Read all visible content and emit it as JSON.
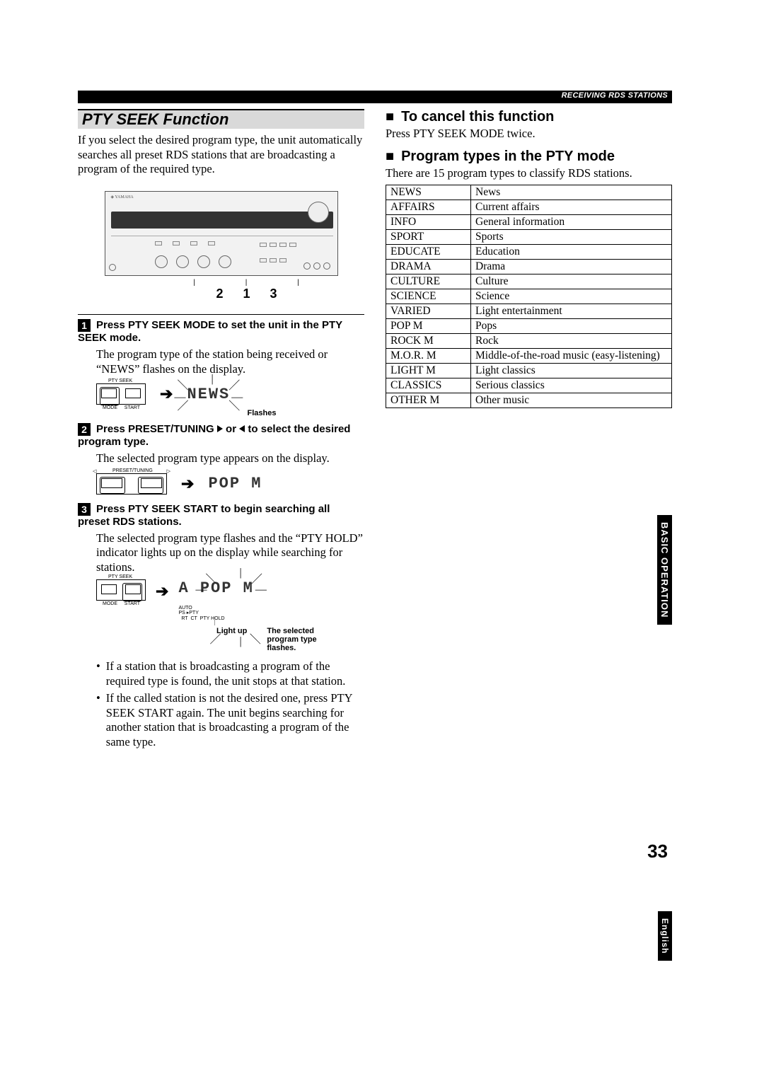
{
  "header": {
    "breadcrumb": "RECEIVING RDS STATIONS"
  },
  "section_title": "PTY SEEK Function",
  "intro": "If you select the desired program type, the unit automatically searches all preset RDS stations that are broadcasting a program of the required type.",
  "callouts": {
    "a": "2",
    "b": "1",
    "c": "3"
  },
  "steps": {
    "s1": {
      "num": "1",
      "head": "Press PTY SEEK MODE to set the unit in the PTY SEEK mode.",
      "body": "The program type of the station being received or “NEWS” flashes on the display.",
      "lcd": "NEWS",
      "flash_label": "Flashes"
    },
    "s2": {
      "num": "2",
      "head_a": "Press PRESET/TUNING ",
      "head_b": " or ",
      "head_c": " to select the desired program type.",
      "body": "The selected program type appears on the display.",
      "lcd": "POP  M"
    },
    "s3": {
      "num": "3",
      "head": "Press PTY SEEK START to begin searching all preset RDS stations.",
      "body": "The selected program type flashes and the “PTY HOLD” indicator lights up on the display while searching for stations.",
      "lcd": "A  POP  M",
      "lightup": "Light up",
      "flash_text": "The selected program type flashes."
    },
    "bullets": [
      "If a station that is broadcasting a program of the required type is found, the unit stops at that station.",
      "If the called station is not the desired one, press PTY SEEK START again. The unit begins searching for another station that is broadcasting a program of the same type."
    ]
  },
  "right": {
    "cancel_head": "To cancel this function",
    "cancel_body": "Press PTY SEEK MODE twice.",
    "pty_head": "Program types in the PTY mode",
    "pty_intro": "There are 15 program types to classify RDS stations.",
    "rows": [
      [
        "NEWS",
        "News"
      ],
      [
        "AFFAIRS",
        "Current affairs"
      ],
      [
        "INFO",
        "General information"
      ],
      [
        "SPORT",
        "Sports"
      ],
      [
        "EDUCATE",
        "Education"
      ],
      [
        "DRAMA",
        "Drama"
      ],
      [
        "CULTURE",
        "Culture"
      ],
      [
        "SCIENCE",
        "Science"
      ],
      [
        "VARIED",
        "Light entertainment"
      ],
      [
        "POP M",
        "Pops"
      ],
      [
        "ROCK M",
        "Rock"
      ],
      [
        "M.O.R. M",
        "Middle-of-the-road music (easy-listening)"
      ],
      [
        "LIGHT M",
        "Light classics"
      ],
      [
        "CLASSICS",
        "Serious classics"
      ],
      [
        "OTHER M",
        "Other music"
      ]
    ]
  },
  "side": {
    "basic": "BASIC OPERATION",
    "english": "English"
  },
  "page_number": "33",
  "tiny": {
    "pty_seek": "PTY SEEK",
    "mode": "MODE",
    "start": "START",
    "preset": "PRESET/TUNING",
    "auto": "AUTO",
    "rt": "RT",
    "ct": "CT",
    "ptyhold": "PTY HOLD",
    "ps": "PS",
    "pty": "PTY"
  }
}
